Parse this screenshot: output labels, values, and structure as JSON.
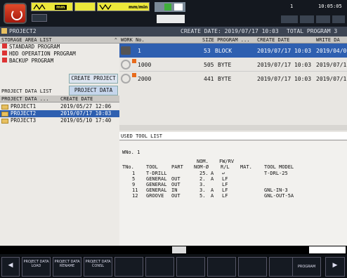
{
  "header": {
    "feed_label": "mm/min",
    "tool_num": "1",
    "clock": "10:05:05"
  },
  "titlebar": {
    "project": "PROJECT2",
    "create_date": "CREATE DATE: 2019/07/17 10:03",
    "total": "TOTAL PROGRAM 3"
  },
  "storage": {
    "title": "STORAGE AREA LIST",
    "items": [
      "STANDARD PROGRAM",
      "HDD OPERATION PROGRAM",
      "BACKUP PROGRAM"
    ]
  },
  "buttons": {
    "create_project": "CREATE PROJECT",
    "project_data": "PROJECT DATA"
  },
  "project_list": {
    "title": "PROJECT DATA LIST",
    "col1": "PROJECT DATA ...",
    "col2": "CREATE DATE",
    "rows": [
      {
        "name": "PROJECT1",
        "date": "2019/05/27 12:06"
      },
      {
        "name": "PROJECT2",
        "date": "2019/07/17 10:03"
      },
      {
        "name": "PROJECT3",
        "date": "2019/05/10 17:40"
      }
    ]
  },
  "programs": {
    "cols": [
      "WORK No.",
      "SIZE PROGRAM ...",
      "CREATE DATE",
      "WRITE DA"
    ],
    "rows": [
      {
        "no": "1",
        "size": "53",
        "unit": "BLOCK",
        "date": "2019/07/17 10:03",
        "wdate": "2019/04/0"
      },
      {
        "no": "1000",
        "size": "505",
        "unit": "BYTE",
        "date": "2019/07/17 10:03",
        "wdate": "2019/07/1"
      },
      {
        "no": "2000",
        "size": "441",
        "unit": "BYTE",
        "date": "2019/07/17 10:03",
        "wdate": "2019/07/1"
      }
    ]
  },
  "tools": {
    "tab": "USED TOOL LIST",
    "wno": "WNo. 1",
    "head1": [
      "",
      "",
      "",
      "NOM.",
      "FW/RV",
      "",
      ""
    ],
    "head2": [
      "TNo.",
      "TOOL",
      "PART",
      "NOM-Ø",
      "R/L",
      "MAT.",
      "TOOL MODEL"
    ],
    "rows": [
      [
        "1",
        "T-DRILL",
        "",
        "25.",
        "A",
        "↩",
        "",
        "T-DRL-25"
      ],
      [
        "5",
        "GENERAL",
        "OUT",
        "2.",
        "A",
        "LF",
        "",
        ""
      ],
      [
        "9",
        "GENERAL",
        "OUT",
        "3.",
        "",
        "LF",
        "",
        ""
      ],
      [
        "11",
        "GENERAL",
        "IN",
        "3.",
        "A",
        "LF",
        "",
        "GNL-IN-3"
      ],
      [
        "12",
        "GROOVE",
        "OUT",
        "5.",
        "A",
        "LF",
        "",
        "GNL-OUT-5A"
      ]
    ]
  },
  "softkeys": {
    "k1": "PROJECT DATA LOAD",
    "k2": "PROJECT DATA RENAME",
    "k3": "PROJECT DATA CONSL",
    "k10": "PROGRAM"
  }
}
